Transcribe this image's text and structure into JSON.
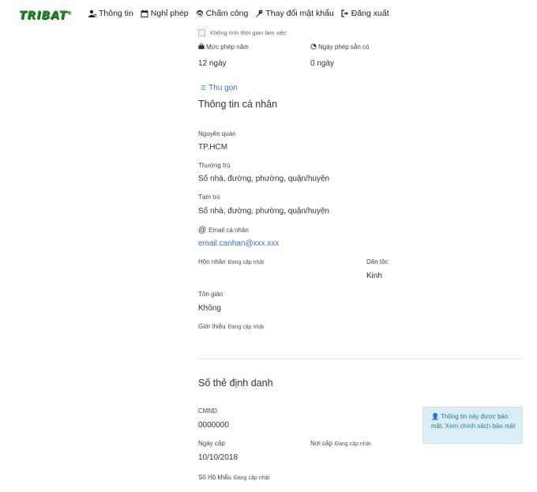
{
  "brand": {
    "logo": "TRIBAT",
    "mark": "®"
  },
  "nav": [
    {
      "label": "Thông tin"
    },
    {
      "label": "Nghỉ phép"
    },
    {
      "label": "Chấm công"
    },
    {
      "label": "Thay đổi mật khẩu"
    },
    {
      "label": "Đăng xuất"
    }
  ],
  "leave": {
    "checkbox_label": "Không tính thời gian làm việc",
    "annual_label": "Mức phép năm",
    "annual_value": "12 ngày",
    "available_label": "Ngày phép sẵn có",
    "available_value": "0 ngày",
    "collapse_label": "Thu gọn"
  },
  "personal": {
    "title": "Thông tin cá nhân",
    "origin_label": "Nguyên quán",
    "origin_value": "TP.HCM",
    "permanent_label": "Thường trú",
    "permanent_value": "Số nhà, đường, phường, quận/huyện",
    "temporary_label": "Tạm trú",
    "temporary_value": "Số nhà, đường, phường, quận/huyện",
    "email_label": "Email cá nhân",
    "email_value": "email.canhan@xxx.xxx",
    "marriage_label": "Hôn nhân",
    "marriage_value": "Đang cập nhật",
    "ethnicity_label": "Dân tộc",
    "ethnicity_value": "Kinh",
    "religion_label": "Tôn giáo",
    "religion_value": "Không",
    "intro_label": "Giới thiệu",
    "intro_value": "Đang cập nhật"
  },
  "identity": {
    "title": "Số thẻ định danh",
    "cmnd_label": "CMND",
    "cmnd_value": "0000000",
    "issue_date_label": "Ngày cấp",
    "issue_date_value": "10/10/2018",
    "issue_place_label": "Nơi cấp",
    "issue_place_value": "Đang cập nhật",
    "household_label": "Số Hộ khẩu",
    "household_value": "Đang cập nhật"
  },
  "notice": {
    "text": "Thông tin này được bảo mật.",
    "link": "Xem chính sách bảo mật"
  },
  "colors": {
    "brand": "#1d8a2c",
    "link": "#3a72c4",
    "notice_bg": "#d9edf7"
  }
}
